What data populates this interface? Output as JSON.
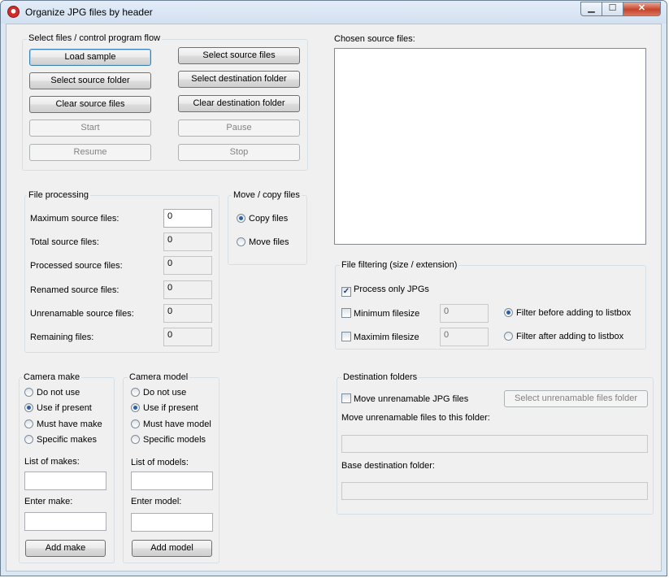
{
  "window": {
    "title": "Organize JPG files by header"
  },
  "caption_buttons": {
    "min": "▁",
    "max": "☐",
    "close": "✕"
  },
  "control_flow": {
    "legend": "Select files / control program flow",
    "load_sample": "Load sample",
    "select_source_files": "Select source files",
    "select_source_folder": "Select source folder",
    "select_destination_folder": "Select destination folder",
    "clear_source_files": "Clear source files",
    "clear_destination_folder": "Clear destination folder",
    "start": "Start",
    "pause": "Pause",
    "resume": "Resume",
    "stop": "Stop"
  },
  "chosen_files": {
    "label": "Chosen source files:"
  },
  "file_processing": {
    "legend": "File processing",
    "max_label": "Maximum source files:",
    "max_value": "0",
    "total_label": "Total source files:",
    "total_value": "0",
    "processed_label": "Processed source files:",
    "processed_value": "0",
    "renamed_label": "Renamed source files:",
    "renamed_value": "0",
    "unrenamable_label": "Unrenamable source files:",
    "unrenamable_value": "0",
    "remaining_label": "Remaining files:",
    "remaining_value": "0"
  },
  "move_copy": {
    "legend": "Move / copy files",
    "copy": "Copy files",
    "move": "Move files",
    "selected": "copy"
  },
  "file_filtering": {
    "legend": "File filtering (size / extension)",
    "process_only_jpgs": "Process only JPGs",
    "process_only_jpgs_checked": true,
    "min_filesize": "Minimum filesize",
    "min_filesize_value": "0",
    "max_filesize": "Maximim filesize",
    "max_filesize_value": "0",
    "filter_before": "Filter before adding to listbox",
    "filter_after": "Filter after adding to listbox",
    "selected": "before"
  },
  "camera_make": {
    "legend": "Camera make",
    "do_not_use": "Do not use",
    "use_if_present": "Use if present",
    "must_have": "Must have make",
    "specific": "Specific makes",
    "selected": "use_if_present",
    "list_label": "List of makes:",
    "enter_label": "Enter make:",
    "add_button": "Add make"
  },
  "camera_model": {
    "legend": "Camera model",
    "do_not_use": "Do not use",
    "use_if_present": "Use if present",
    "must_have": "Must have model",
    "specific": "Specific models",
    "selected": "use_if_present",
    "list_label": "List of models:",
    "enter_label": "Enter model:",
    "add_button": "Add model"
  },
  "destination": {
    "legend": "Destination folders",
    "move_unrenamable": "Move unrenamable JPG files",
    "select_unrenamable_button": "Select unrenamable files folder",
    "move_to_label": "Move unrenamable files to this folder:",
    "base_label": "Base destination folder:"
  }
}
